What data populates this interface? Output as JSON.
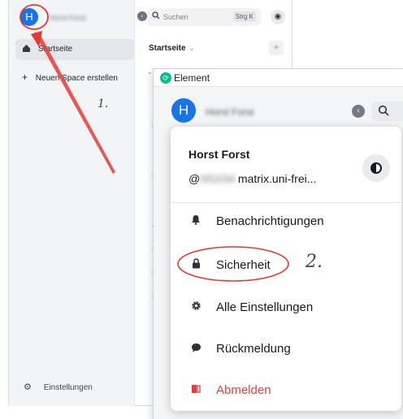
{
  "background_window": {
    "avatar_letter": "H",
    "blurred_name": "Horst Forst",
    "collapse_icon": "chevron-left-icon",
    "search": {
      "placeholder": "Suchen",
      "shortcut": "Strg K"
    },
    "explore_icon": "compass-icon",
    "sidebar": {
      "home_label": "Startseite",
      "new_space_label": "Neuen Space erstellen",
      "settings_label": "Einstellungen"
    },
    "room_list_header": "Startseite",
    "room_list_header_chevron": "⌄",
    "add_label": "+"
  },
  "foreground_window": {
    "title": "Element",
    "avatar_letter": "H",
    "blurred_name": "Horst Forst"
  },
  "user_menu": {
    "display_name": "Horst Forst",
    "mxid_prefix": "@",
    "mxid_blurred": "hf1034",
    "mxid_suffix": " matrix.uni-frei...",
    "theme_toggle_icon": "theme-contrast-icon",
    "items": [
      {
        "label": "Benachrichtigungen",
        "icon": "bell-icon"
      },
      {
        "label": "Sicherheit",
        "icon": "lock-icon"
      },
      {
        "label": "Alle Einstellungen",
        "icon": "gear-icon"
      },
      {
        "label": "Rückmeldung",
        "icon": "chat-bubble-icon"
      },
      {
        "label": "Abmelden",
        "icon": "sign-out-icon",
        "danger": true
      }
    ]
  },
  "annotations": {
    "step1": "1.",
    "step2": "2.",
    "color": "#e53935"
  }
}
